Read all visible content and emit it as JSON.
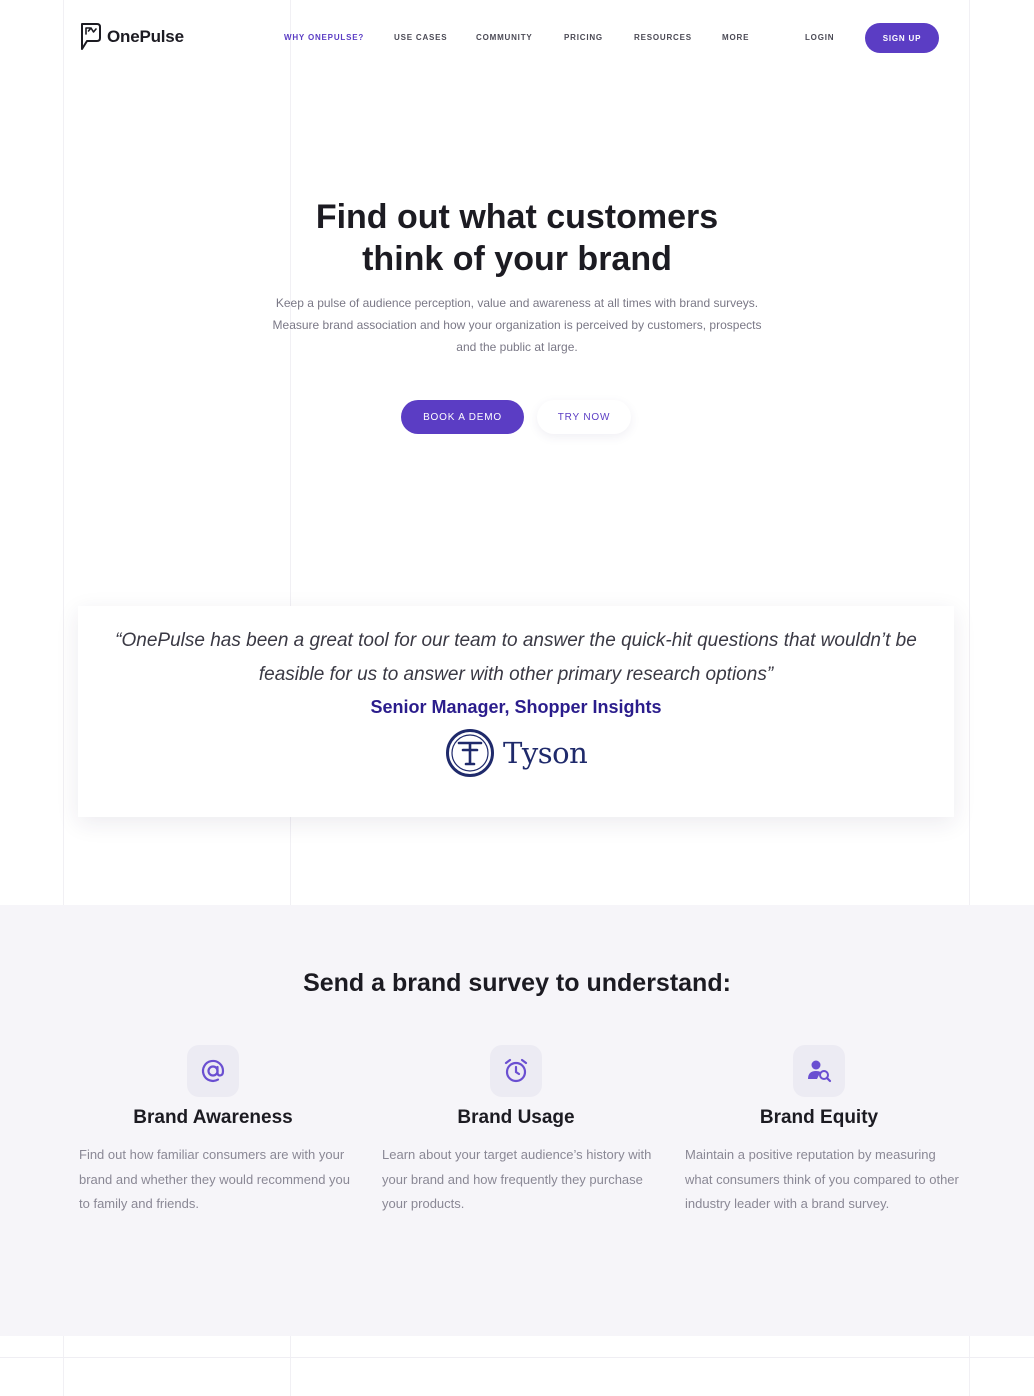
{
  "brand": {
    "name": "OnePulse",
    "accent": "#5b3dc4",
    "dark_accent": "#2b1d8c"
  },
  "nav": {
    "items": [
      {
        "label": "WHY ONEPULSE?",
        "active": true
      },
      {
        "label": "USE CASES",
        "active": false
      },
      {
        "label": "COMMUNITY",
        "active": false
      },
      {
        "label": "PRICING",
        "active": false
      },
      {
        "label": "RESOURCES",
        "active": false
      },
      {
        "label": "MORE",
        "active": false
      }
    ],
    "login": "LOGIN",
    "signup": "SIGN UP"
  },
  "hero": {
    "title_line1": "Find out what customers",
    "title_line2": "think of your brand",
    "subtitle": "Keep a pulse of audience perception, value and awareness at all times with brand surveys. Measure brand association and how your organization is perceived by customers, prospects and the public at large.",
    "cta_primary": "BOOK A DEMO",
    "cta_secondary": "TRY NOW"
  },
  "testimonial": {
    "quote": "“OnePulse has been a great tool for our team to answer the quick-hit questions that wouldn’t be feasible for us to answer with other primary research options”",
    "author": "Senior Manager, Shopper Insights",
    "company": "Tyson",
    "company_icon": "tyson-logo"
  },
  "features": {
    "title": "Send a brand survey to understand:",
    "items": [
      {
        "icon": "at-sign-icon",
        "title": "Brand Awareness",
        "desc": "Find out how familiar consumers are with your brand and whether they would recommend you to family and friends."
      },
      {
        "icon": "alarm-clock-icon",
        "title": "Brand Usage",
        "desc": "Learn about your target audience’s history with your brand and how frequently they purchase your products."
      },
      {
        "icon": "user-search-icon",
        "title": "Brand Equity",
        "desc": "Maintain a positive reputation by measuring what consumers think of you compared to other industry leader with a brand survey."
      }
    ]
  }
}
